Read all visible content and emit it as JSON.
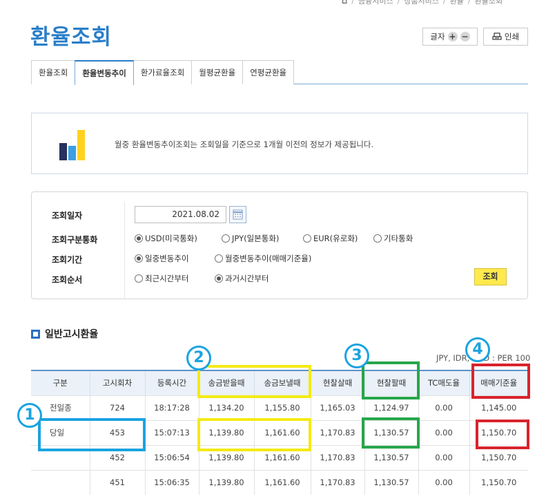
{
  "breadcrumb": [
    "금융서비스",
    "상품서비스",
    "환율",
    "환율조회"
  ],
  "page_title": "환율조회",
  "tools": {
    "font_label": "글자",
    "font_plus": "+",
    "font_minus": "−",
    "print_label": "인쇄"
  },
  "tabs": [
    {
      "label": "환율조회",
      "active": false
    },
    {
      "label": "환율변동추이",
      "active": true
    },
    {
      "label": "환가료율조회",
      "active": false
    },
    {
      "label": "월평균환율",
      "active": false
    },
    {
      "label": "연평균환율",
      "active": false
    }
  ],
  "info_text": "월중 환율변동추이조회는 조회일을 기준으로 1개월 이전의 정보가 제공됩니다.",
  "search": {
    "date_label": "조회일자",
    "date_value": "2021.08.02",
    "currency_label": "조회구분통화",
    "currency_options": [
      "USD(미국통화)",
      "JPY(일본통화)",
      "EUR(유로화)",
      "기타통화"
    ],
    "currency_selected": 0,
    "period_label": "조회기간",
    "period_options": [
      "일중변동추이",
      "월중변동추이(매매기준율)"
    ],
    "period_selected": 0,
    "order_label": "조회순서",
    "order_options": [
      "최근시간부터",
      "과거시간부터"
    ],
    "order_selected": 1,
    "search_button": "조회"
  },
  "section_title": "일반고시환율",
  "unit_note": "JPY, IDR, VND : PER 100",
  "table": {
    "headers": [
      "구분",
      "고시회차",
      "등록시간",
      "송금받을때",
      "송금보낼때",
      "현찰살때",
      "현찰팔때",
      "TC매도율",
      "매매기준율"
    ],
    "rows": [
      [
        "전일종",
        "724",
        "18:17:28",
        "1,134.20",
        "1,155.80",
        "1,165.03",
        "1,124.97",
        "0.00",
        "1,145.00"
      ],
      [
        "당일",
        "453",
        "15:07:13",
        "1,139.80",
        "1,161.60",
        "1,170.83",
        "1,130.57",
        "0.00",
        "1,150.70"
      ],
      [
        "",
        "452",
        "15:06:54",
        "1,139.80",
        "1,161.60",
        "1,170.83",
        "1,130.57",
        "0.00",
        "1,150.70"
      ],
      [
        "",
        "451",
        "15:06:35",
        "1,139.80",
        "1,161.60",
        "1,170.83",
        "1,130.57",
        "0.00",
        "1,150.70"
      ]
    ]
  },
  "badges": [
    "1",
    "2",
    "3",
    "4"
  ],
  "colors": {
    "accent": "#2a7fc9",
    "highlight_blue": "#1aa3e0",
    "highlight_yellow": "#f4ea14",
    "highlight_green": "#27a64b",
    "highlight_red": "#d9232d",
    "button_yellow": "#ffe94d"
  }
}
